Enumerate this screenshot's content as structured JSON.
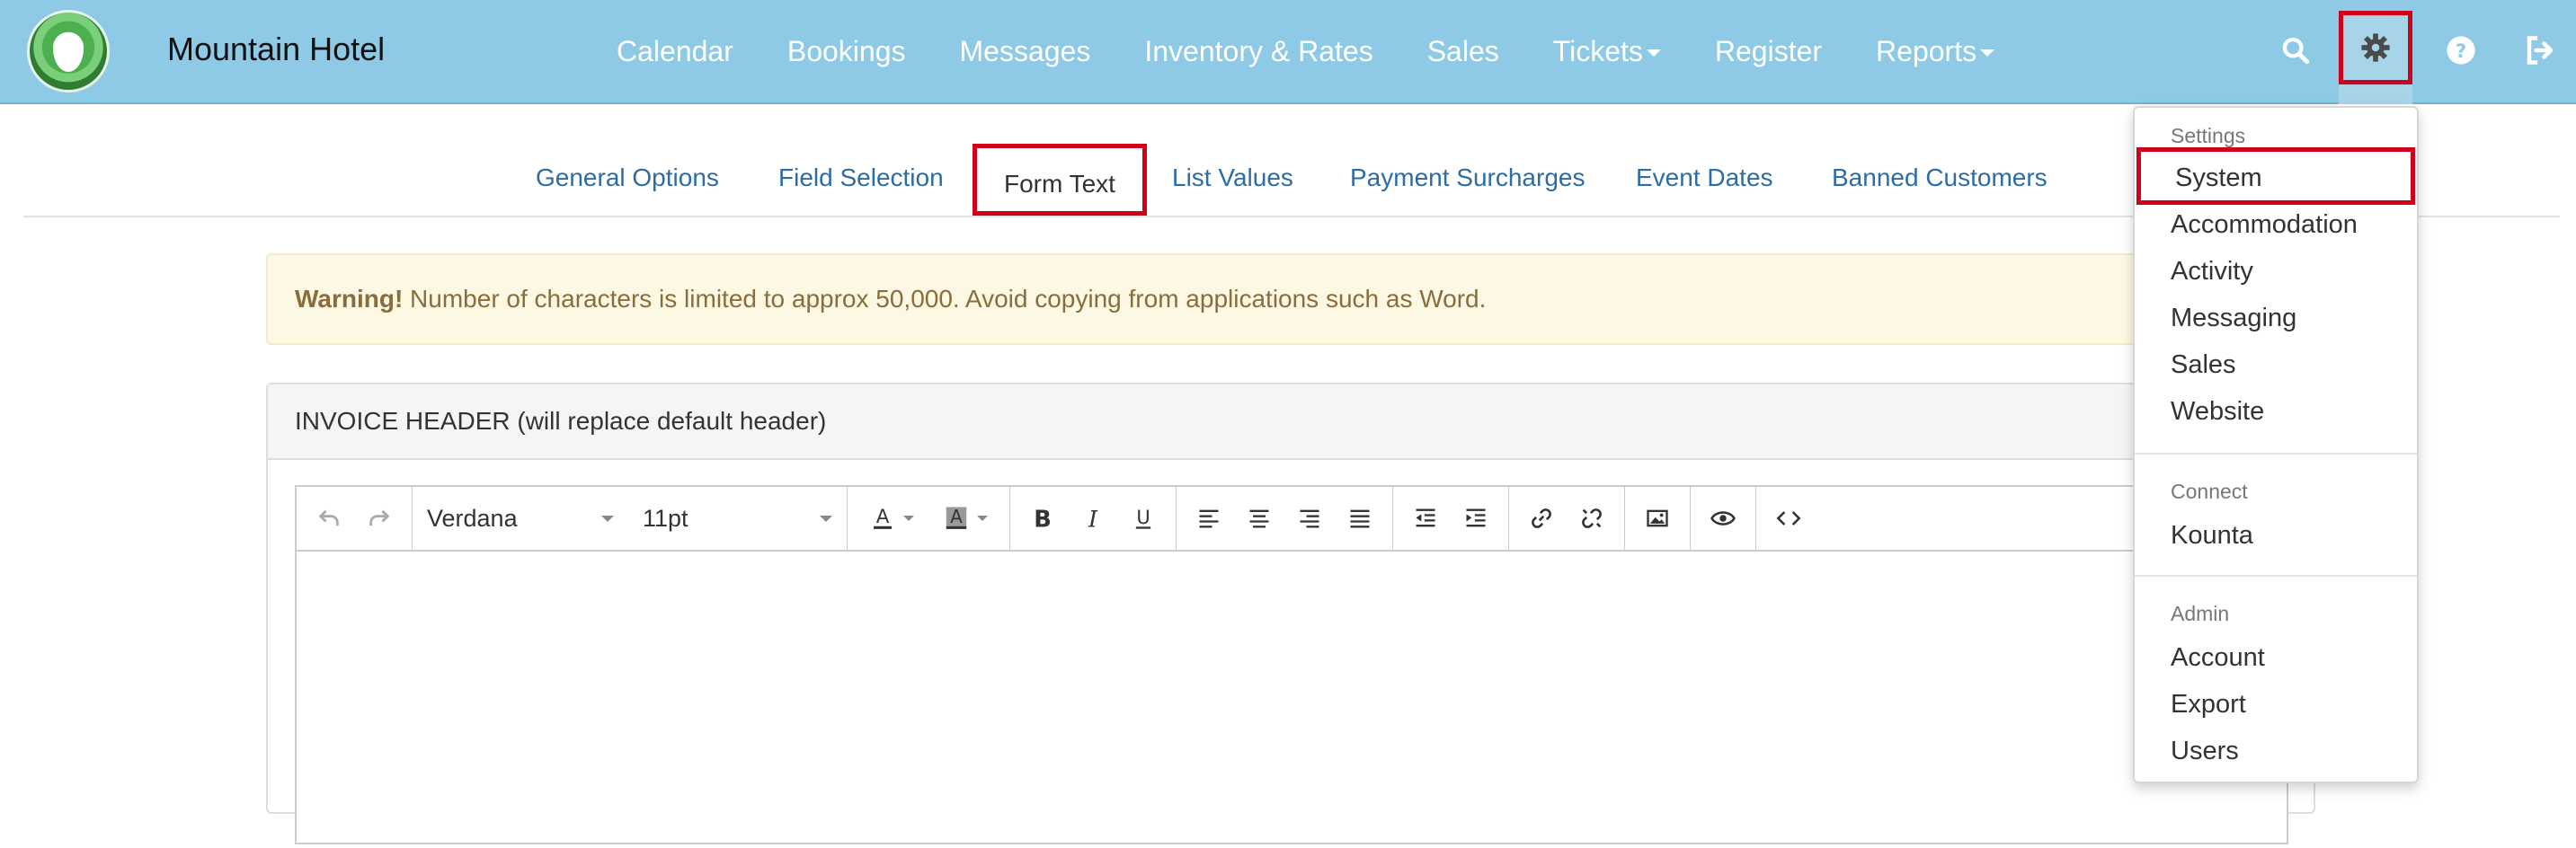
{
  "brand": {
    "name": "Mountain Hotel"
  },
  "nav": {
    "links": [
      {
        "label": "Calendar"
      },
      {
        "label": "Bookings"
      },
      {
        "label": "Messages"
      },
      {
        "label": "Inventory & Rates"
      },
      {
        "label": "Sales"
      },
      {
        "label": "Tickets",
        "dropdown": true
      },
      {
        "label": "Register"
      },
      {
        "label": "Reports",
        "dropdown": true
      }
    ],
    "icons": [
      "search-icon",
      "gear-icon",
      "help-icon",
      "logout-icon"
    ]
  },
  "subtabs": [
    {
      "label": "General Options"
    },
    {
      "label": "Field Selection"
    },
    {
      "label": "Form Text",
      "active": true
    },
    {
      "label": "List Values"
    },
    {
      "label": "Payment Surcharges"
    },
    {
      "label": "Event Dates"
    },
    {
      "label": "Banned Customers"
    }
  ],
  "warning": {
    "strong": "Warning!",
    "text": " Number of characters is limited to approx 50,000. Avoid copying from applications such as Word."
  },
  "panel": {
    "title": "INVOICE HEADER (will replace default header)",
    "editor": {
      "font_family": "Verdana",
      "font_size": "11pt"
    }
  },
  "dropdown": {
    "sections": [
      {
        "header": "Settings",
        "items": [
          "System",
          "Accommodation",
          "Activity",
          "Messaging",
          "Sales",
          "Website"
        ]
      },
      {
        "header": "Connect",
        "items": [
          "Kounta"
        ]
      },
      {
        "header": "Admin",
        "items": [
          "Account",
          "Export",
          "Users"
        ]
      }
    ],
    "active_item": "System"
  },
  "colors": {
    "navbar": "#8ecae6",
    "link": "#2d6da3",
    "highlight": "#d0021b",
    "warning_bg": "#fcf8e3",
    "warning_text": "#8a6d3b"
  }
}
